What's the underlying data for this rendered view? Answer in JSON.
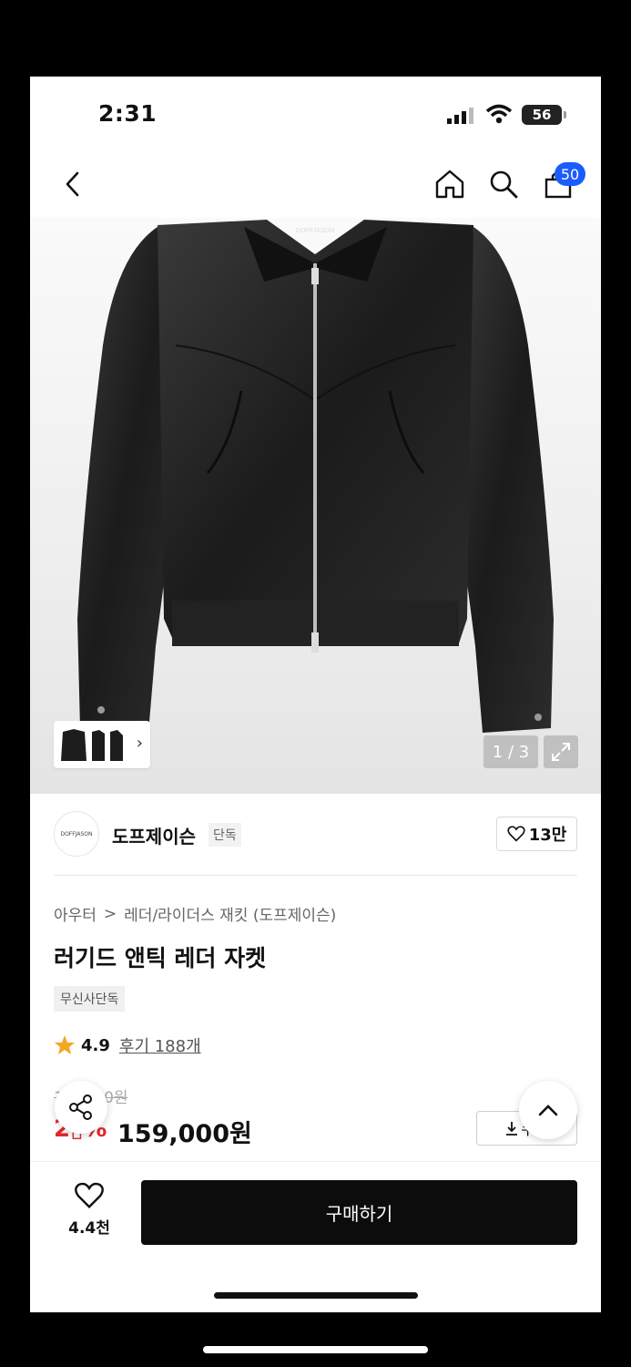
{
  "status_bar": {
    "time": "2:31",
    "battery": "56"
  },
  "nav": {
    "cart_count": "50",
    "icons": [
      "back-icon",
      "home-icon",
      "search-icon",
      "cart-icon"
    ]
  },
  "gallery": {
    "counter": "1 / 3",
    "product_logo": "DOFFJASON"
  },
  "brand": {
    "logo_text": "DOFFJASON",
    "name": "도프제이슨",
    "tag": "단독",
    "likes": "13만"
  },
  "breadcrumb": {
    "category": "아우터",
    "separator": ">",
    "subcategory": "레더/라이더스 재킷 (도프제이슨)"
  },
  "product": {
    "title": "러기드 앤틱 레더 자켓",
    "exclusive_badge": "무신사단독",
    "rating": "4.9",
    "reviews": "후기 188개",
    "original_price": "1▯▯,▯00원",
    "discount": "2▯%",
    "price": "159,000원",
    "coupon_label": "쿠폰"
  },
  "bottom": {
    "wish_count": "4.4천",
    "buy_label": "구매하기"
  },
  "colors": {
    "accent_blue": "#1a5cff",
    "discount_red": "#e4262b",
    "star": "#f5a623",
    "buy_button": "#0c0c0c"
  }
}
